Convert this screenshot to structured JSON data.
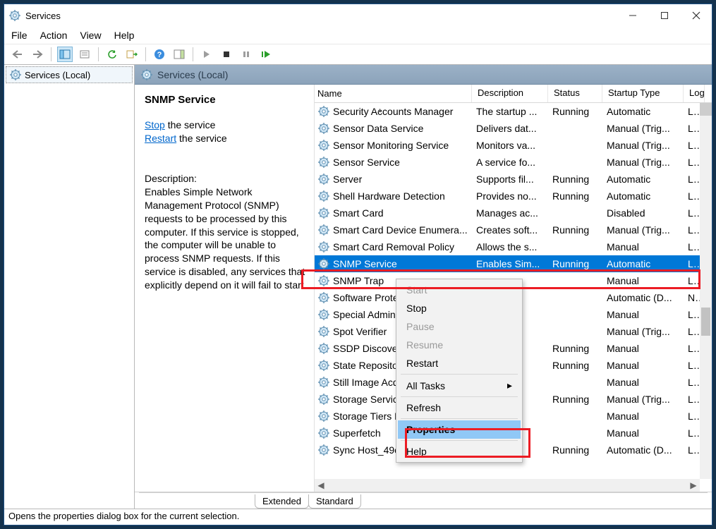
{
  "window": {
    "title": "Services"
  },
  "menu": {
    "file": "File",
    "action": "Action",
    "view": "View",
    "help": "Help"
  },
  "nav": {
    "label": "Services (Local)"
  },
  "contentHeader": "Services (Local)",
  "detail": {
    "selectedName": "SNMP Service",
    "stopWord": "Stop",
    "stopRest": " the service",
    "restartWord": "Restart",
    "restartRest": " the service",
    "descLabel": "Description:",
    "descText": "Enables Simple Network Management Protocol (SNMP) requests to be processed by this computer. If this service is stopped, the computer will be unable to process SNMP requests. If this service is disabled, any services that explicitly depend on it will fail to start."
  },
  "columns": {
    "name": "Name",
    "desc": "Description",
    "status": "Status",
    "startup": "Startup Type",
    "logon": "Log"
  },
  "rows": [
    {
      "name": "Security Accounts Manager",
      "desc": "The startup ...",
      "status": "Running",
      "startup": "Automatic",
      "logon": "Loc"
    },
    {
      "name": "Sensor Data Service",
      "desc": "Delivers dat...",
      "status": "",
      "startup": "Manual (Trig...",
      "logon": "Loc"
    },
    {
      "name": "Sensor Monitoring Service",
      "desc": "Monitors va...",
      "status": "",
      "startup": "Manual (Trig...",
      "logon": "Loc"
    },
    {
      "name": "Sensor Service",
      "desc": "A service fo...",
      "status": "",
      "startup": "Manual (Trig...",
      "logon": "Loc"
    },
    {
      "name": "Server",
      "desc": "Supports fil...",
      "status": "Running",
      "startup": "Automatic",
      "logon": "Loc"
    },
    {
      "name": "Shell Hardware Detection",
      "desc": "Provides no...",
      "status": "Running",
      "startup": "Automatic",
      "logon": "Loc"
    },
    {
      "name": "Smart Card",
      "desc": "Manages ac...",
      "status": "",
      "startup": "Disabled",
      "logon": "Loc"
    },
    {
      "name": "Smart Card Device Enumera...",
      "desc": "Creates soft...",
      "status": "Running",
      "startup": "Manual (Trig...",
      "logon": "Loc"
    },
    {
      "name": "Smart Card Removal Policy",
      "desc": "Allows the s...",
      "status": "",
      "startup": "Manual",
      "logon": "Loc"
    },
    {
      "name": "SNMP Service",
      "desc": "Enables Sim...",
      "status": "Running",
      "startup": "Automatic",
      "logon": "Loc",
      "selected": true
    },
    {
      "name": "SNMP Trap",
      "desc": "",
      "status": "",
      "startup": "Manual",
      "logon": "Loc"
    },
    {
      "name": "Software Protect",
      "desc": "",
      "status": "",
      "startup": "Automatic (D...",
      "logon": "Net"
    },
    {
      "name": "Special Administ",
      "desc": "",
      "status": "",
      "startup": "Manual",
      "logon": "Loc"
    },
    {
      "name": "Spot Verifier",
      "desc": "",
      "status": "",
      "startup": "Manual (Trig...",
      "logon": "Loc"
    },
    {
      "name": "SSDP Discovery",
      "desc": "",
      "status": "Running",
      "startup": "Manual",
      "logon": "Loc"
    },
    {
      "name": "State Repository",
      "desc": "",
      "status": "Running",
      "startup": "Manual",
      "logon": "Loc"
    },
    {
      "name": "Still Image Acqu",
      "desc": "",
      "status": "",
      "startup": "Manual",
      "logon": "Loc"
    },
    {
      "name": "Storage Service",
      "desc": "",
      "status": "Running",
      "startup": "Manual (Trig...",
      "logon": "Loc"
    },
    {
      "name": "Storage Tiers M",
      "desc": "",
      "status": "",
      "startup": "Manual",
      "logon": "Loc"
    },
    {
      "name": "Superfetch",
      "desc": "",
      "status": "",
      "startup": "Manual",
      "logon": "Loc"
    },
    {
      "name": "Sync Host_49c40",
      "desc": "",
      "status": "Running",
      "startup": "Automatic (D...",
      "logon": "Loc"
    }
  ],
  "contextMenu": {
    "start": "Start",
    "stop": "Stop",
    "pause": "Pause",
    "resume": "Resume",
    "restart": "Restart",
    "allTasks": "All Tasks",
    "refresh": "Refresh",
    "properties": "Properties",
    "help": "Help"
  },
  "tabs": {
    "extended": "Extended",
    "standard": "Standard"
  },
  "statusbar": "Opens the properties dialog box for the current selection."
}
